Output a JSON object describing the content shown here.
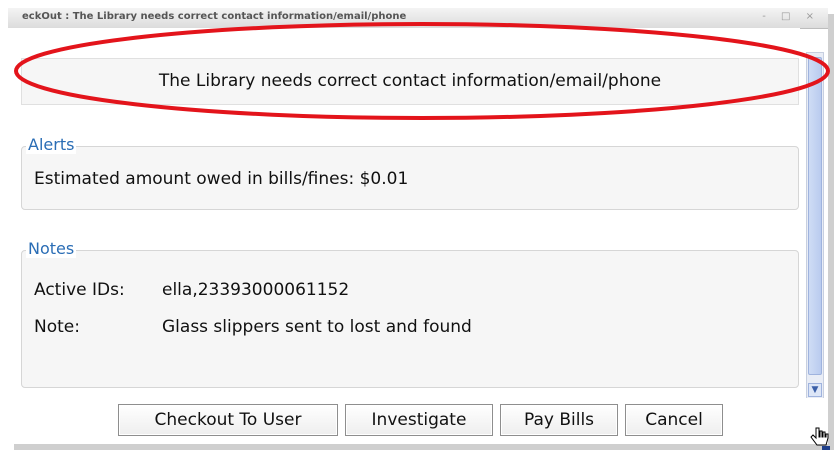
{
  "window": {
    "title": "eckOut : The Library needs correct contact information/email/phone",
    "controls": "- □ ×"
  },
  "message": {
    "text": "The Library needs correct contact information/email/phone"
  },
  "alerts": {
    "legend": "Alerts",
    "text": "Estimated amount owed in bills/fines: $0.01"
  },
  "notes": {
    "legend": "Notes",
    "rows": [
      {
        "label": "Active IDs:",
        "value": "ella,23393000061152"
      },
      {
        "label": "Note:",
        "value": "Glass slippers sent to lost and found"
      }
    ]
  },
  "buttons": {
    "checkout": "Checkout To User",
    "investigate": "Investigate",
    "pay_bills": "Pay Bills",
    "cancel": "Cancel"
  },
  "colors": {
    "annotation": "#e3141b",
    "legend": "#2a6db5"
  },
  "icons": {
    "scroll_down": "chevron-down-icon",
    "cursor": "hand-cursor-icon"
  }
}
